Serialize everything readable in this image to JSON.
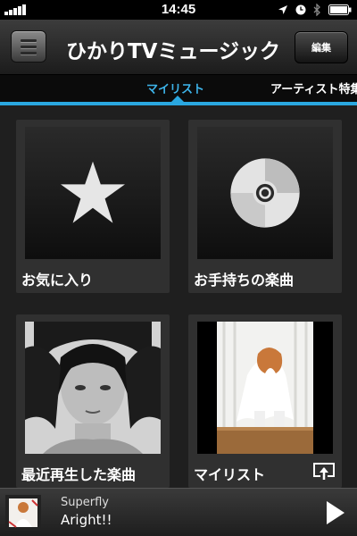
{
  "status_bar": {
    "time": "14:45"
  },
  "header": {
    "title": "ひかりTVミュージック",
    "edit_label": "編集"
  },
  "tabs": [
    {
      "label": "マイリスト",
      "active": true
    },
    {
      "label": "アーティスト特集",
      "active": false
    }
  ],
  "cards": [
    {
      "label": "お気に入り",
      "icon": "star-icon"
    },
    {
      "label": "お手持ちの楽曲",
      "icon": "cd-icon"
    },
    {
      "label": "最近再生した楽曲",
      "icon": "album-art"
    },
    {
      "label": "マイリスト",
      "icon": "album-art"
    }
  ],
  "player": {
    "artist": "Superfly",
    "track": "Aright!!"
  },
  "colors": {
    "accent": "#2aa7e0",
    "active_tab_text": "#3db4ea"
  }
}
